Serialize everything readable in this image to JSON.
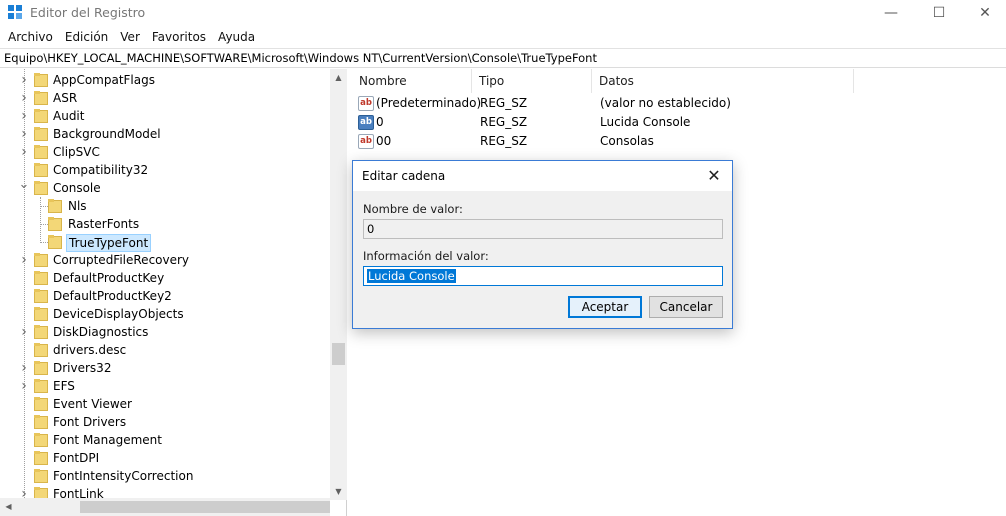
{
  "window": {
    "title": "Editor del Registro",
    "minimize": "—",
    "maximize": "☐",
    "close": "✕"
  },
  "menu": [
    "Archivo",
    "Edición",
    "Ver",
    "Favoritos",
    "Ayuda"
  ],
  "address": "Equipo\\HKEY_LOCAL_MACHINE\\SOFTWARE\\Microsoft\\Windows NT\\CurrentVersion\\Console\\TrueTypeFont",
  "tree": {
    "items": [
      {
        "label": "AppCompatFlags",
        "expandable": true
      },
      {
        "label": "ASR",
        "expandable": true
      },
      {
        "label": "Audit",
        "expandable": true
      },
      {
        "label": "BackgroundModel",
        "expandable": true
      },
      {
        "label": "ClipSVC",
        "expandable": true
      },
      {
        "label": "Compatibility32",
        "expandable": false
      },
      {
        "label": "Console",
        "expandable": true,
        "expanded": true
      },
      {
        "label": "Nls",
        "child": true
      },
      {
        "label": "RasterFonts",
        "child": true
      },
      {
        "label": "TrueTypeFont",
        "child": true,
        "selected": true
      },
      {
        "label": "CorruptedFileRecovery",
        "expandable": true
      },
      {
        "label": "DefaultProductKey",
        "expandable": false
      },
      {
        "label": "DefaultProductKey2",
        "expandable": false
      },
      {
        "label": "DeviceDisplayObjects",
        "expandable": false
      },
      {
        "label": "DiskDiagnostics",
        "expandable": true
      },
      {
        "label": "drivers.desc",
        "expandable": false
      },
      {
        "label": "Drivers32",
        "expandable": true
      },
      {
        "label": "EFS",
        "expandable": true
      },
      {
        "label": "Event Viewer",
        "expandable": false
      },
      {
        "label": "Font Drivers",
        "expandable": false
      },
      {
        "label": "Font Management",
        "expandable": false
      },
      {
        "label": "FontDPI",
        "expandable": false
      },
      {
        "label": "FontIntensityCorrection",
        "expandable": false
      },
      {
        "label": "FontLink",
        "expandable": true
      }
    ]
  },
  "list": {
    "columns": {
      "name": "Nombre",
      "type": "Tipo",
      "data": "Datos"
    },
    "rows": [
      {
        "icon": "ab",
        "name": "(Predeterminado)",
        "type": "REG_SZ",
        "data": "(valor no establecido)"
      },
      {
        "icon": "bin",
        "name": "0",
        "type": "REG_SZ",
        "data": "Lucida Console"
      },
      {
        "icon": "ab",
        "name": "00",
        "type": "REG_SZ",
        "data": "Consolas"
      }
    ]
  },
  "dialog": {
    "title": "Editar cadena",
    "close": "✕",
    "name_label": "Nombre de valor:",
    "name_value": "0",
    "data_label": "Información del valor:",
    "data_value": "Lucida Console",
    "ok": "Aceptar",
    "cancel": "Cancelar"
  },
  "colors": {
    "accent": "#0078d7",
    "folder": "#f3d777",
    "selection": "#cce8ff"
  }
}
